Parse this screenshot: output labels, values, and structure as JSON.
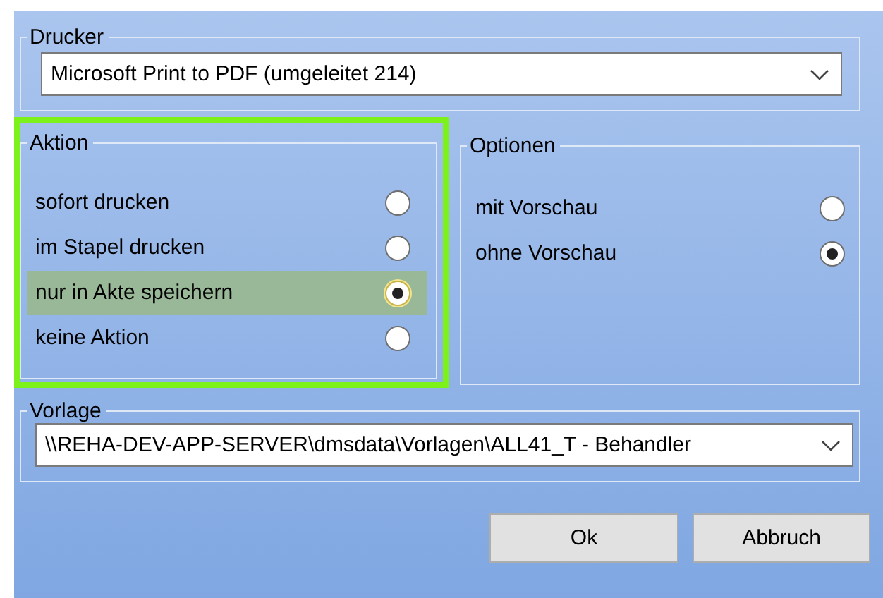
{
  "printer": {
    "label": "Drucker",
    "value": "Microsoft Print to PDF (umgeleitet 214)"
  },
  "action": {
    "label": "Aktion",
    "highlighted": true,
    "options": [
      {
        "label": "sofort drucken",
        "selected": false,
        "focused": false
      },
      {
        "label": "im Stapel drucken",
        "selected": false,
        "focused": false
      },
      {
        "label": "nur in Akte speichern",
        "selected": true,
        "focused": true
      },
      {
        "label": "keine Aktion",
        "selected": false,
        "focused": false
      }
    ]
  },
  "options": {
    "label": "Optionen",
    "options": [
      {
        "label": "mit Vorschau",
        "selected": false
      },
      {
        "label": "ohne Vorschau",
        "selected": true
      }
    ]
  },
  "template": {
    "label": "Vorlage",
    "value": "\\\\REHA-DEV-APP-SERVER\\dmsdata\\Vorlagen\\ALL41_T - Behandler"
  },
  "buttons": [
    "Ok",
    "Abbruch"
  ]
}
